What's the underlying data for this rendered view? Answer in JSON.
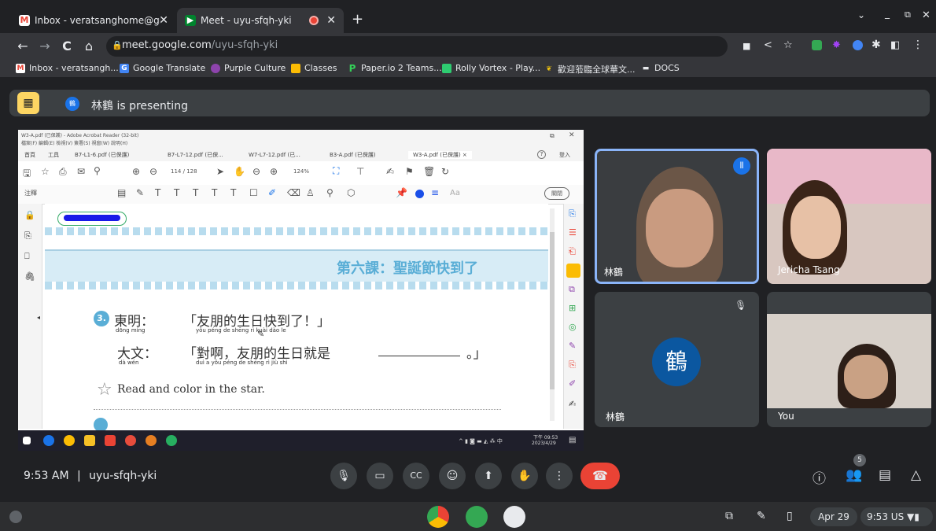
{
  "browser": {
    "tabs": [
      {
        "title": "Inbox - veratsanghome@gmail.c",
        "close": "✕"
      },
      {
        "title": "Meet - uyu-sfqh-yki",
        "close": "✕"
      }
    ],
    "new_tab": "+",
    "url": {
      "host": "meet.google.com",
      "path": "/uyu-sfqh-yki"
    },
    "bookmarks": [
      "Inbox - veratsangh...",
      "Google Translate",
      "Purple Culture",
      "Classes",
      "Paper.io 2 Teams...",
      "Rolly Vortex - Play...",
      "歡迎蒞臨全球華文...",
      "DOCS"
    ]
  },
  "meet": {
    "presenting_text": "林鶴 is presenting",
    "presenter_avatar": "鶴",
    "clock": "9:53 AM",
    "separator": "|",
    "meeting_code": "uyu-sfqh-yki",
    "participant_count": "5",
    "tiles": [
      {
        "name": "林鶴"
      },
      {
        "name": "Jericha Tsang"
      },
      {
        "name": "林鶴",
        "avatar": "鶴"
      },
      {
        "name": "You"
      }
    ]
  },
  "shared_screen": {
    "window_title": "W3-A.pdf (已保護) - Adobe Acrobat Reader (32-bit)",
    "menu": "檔案(F)  編輯(E)  檢視(V)  簽署(S)  視窗(W)  說明(H)",
    "home": "首頁",
    "tools": "工具",
    "doc_tabs": [
      "B7-L1-6.pdf (已保護)",
      "B7-L7-12.pdf (已保...",
      "W7-L7-12.pdf (已...",
      "B3-A.pdf (已保護)",
      "W3-A.pdf (已保護)"
    ],
    "tab_close": "×",
    "help": "?",
    "signin": "登入",
    "page": "114",
    "page_total": "/ 128",
    "zoom": "124%",
    "annotate": "注釋",
    "close_btn": "關閉",
    "aa": "Aa",
    "banner_title": "第六課：聖誕節快到了",
    "item_num": "3.",
    "line1_speaker": "東明：",
    "line1_speaker_py": "dōng míng",
    "line1_text": "「友朋的生日快到了！」",
    "line1_py": "yǒu péng  de  shēng  rì  kuài  dào  le",
    "line2_speaker": "大文：",
    "line2_speaker_py": "dà  wén",
    "line2_text": "「對啊，友朋的生日就是",
    "line2_end": "。」",
    "line2_py": "duì  a      yǒu péng  de  shēng  rì  jiù  shì",
    "read_color": "Read and color in the star.",
    "task_clock": "下午 09:53",
    "task_date": "2023/4/29"
  },
  "shelf": {
    "date": "Apr 29",
    "time": "9:53",
    "region": "US"
  },
  "colors": {
    "accent": "#1a73e8",
    "end_call": "#ea4335",
    "banner": "#d7ecf6",
    "banner_text": "#5aaed6"
  }
}
